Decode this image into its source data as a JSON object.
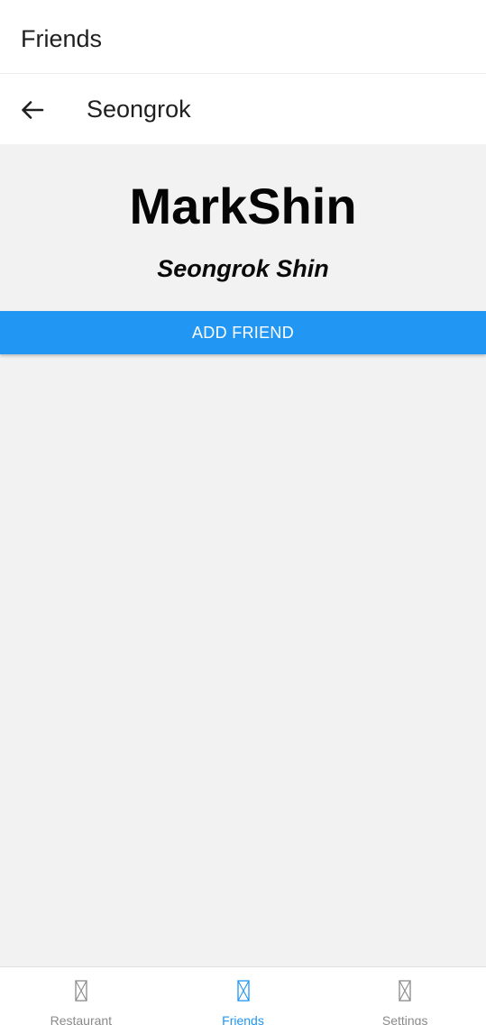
{
  "app_header": {
    "title": "Friends"
  },
  "sub_header": {
    "title": "Seongrok"
  },
  "profile": {
    "username": "MarkShin",
    "full_name": "Seongrok Shin",
    "add_button_label": "ADD FRIEND"
  },
  "bottom_nav": {
    "items": [
      {
        "label": "Restaurant",
        "icon": "placeholder-icon",
        "active": false
      },
      {
        "label": "Friends",
        "icon": "placeholder-icon",
        "active": true
      },
      {
        "label": "Settings",
        "icon": "placeholder-icon",
        "active": false
      }
    ]
  },
  "colors": {
    "accent": "#2196f3",
    "background": "#f2f2f2",
    "inactive": "#8a8a8a"
  }
}
